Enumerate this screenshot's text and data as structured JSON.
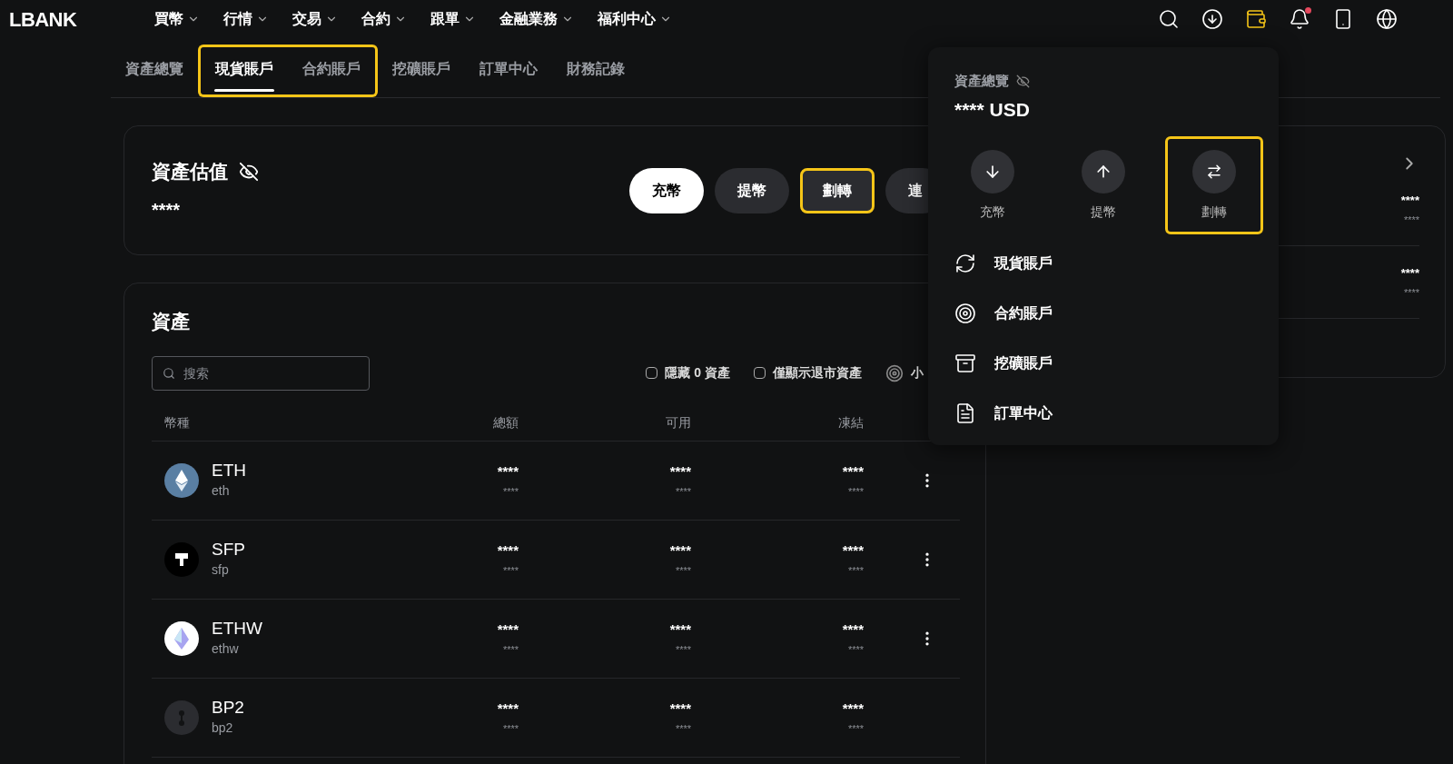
{
  "logo": "LBANK",
  "nav": [
    "買幣",
    "行情",
    "交易",
    "合約",
    "跟單",
    "金融業務",
    "福利中心"
  ],
  "header_icons": [
    {
      "kind": "search",
      "highlighted": false
    },
    {
      "kind": "download",
      "highlighted": false
    },
    {
      "kind": "wallet",
      "highlighted": true
    },
    {
      "kind": "bell",
      "unread": true,
      "highlighted": false
    },
    {
      "kind": "app",
      "highlighted": false
    },
    {
      "kind": "globe",
      "highlighted": false
    }
  ],
  "tabs": [
    {
      "label": "資產總覽",
      "selected": false,
      "highlighted": false
    },
    {
      "label": "現貨賬戶",
      "selected": true,
      "highlighted": true
    },
    {
      "label": "合約賬戶",
      "selected": false,
      "highlighted": true
    },
    {
      "label": "挖礦賬戶",
      "selected": false,
      "highlighted": false
    },
    {
      "label": "訂單中心",
      "selected": false,
      "highlighted": false
    },
    {
      "label": "財務記錄",
      "selected": false,
      "highlighted": false
    }
  ],
  "valuation": {
    "title": "資產估值",
    "value": "****",
    "buttons": [
      {
        "label": "充幣",
        "primary": true,
        "highlighted": false
      },
      {
        "label": "提幣",
        "primary": false,
        "highlighted": false
      },
      {
        "label": "劃轉",
        "primary": false,
        "highlighted": true
      },
      {
        "label": "連",
        "primary": false,
        "highlighted": false
      }
    ]
  },
  "assets": {
    "title": "資產",
    "search": {
      "placeholder": "搜索"
    },
    "filters": [
      {
        "kind": "checkbox",
        "label": "隱藏 0 資產",
        "checked": false
      },
      {
        "kind": "checkbox",
        "label": "僅顯示退市資產",
        "checked": false
      },
      {
        "kind": "toggle",
        "label": "小"
      }
    ],
    "columns": [
      "幣種",
      "總額",
      "可用",
      "凍結"
    ],
    "rows": [
      {
        "coin": "ETH",
        "code": "eth",
        "kind": "eth",
        "total": "****",
        "total_sub": "****",
        "available": "****",
        "available_sub": "****",
        "frozen": "****",
        "frozen_sub": "****",
        "menu": true
      },
      {
        "coin": "SFP",
        "code": "sfp",
        "kind": "sfp",
        "total": "****",
        "total_sub": "****",
        "available": "****",
        "available_sub": "****",
        "frozen": "****",
        "frozen_sub": "****",
        "menu": true
      },
      {
        "coin": "ETHW",
        "code": "ethw",
        "kind": "ethw",
        "total": "****",
        "total_sub": "****",
        "available": "****",
        "available_sub": "****",
        "frozen": "****",
        "frozen_sub": "****",
        "menu": true
      },
      {
        "coin": "BP2",
        "code": "bp2",
        "kind": "bp2",
        "total": "****",
        "total_sub": "****",
        "available": "****",
        "available_sub": "****",
        "frozen": "****",
        "frozen_sub": "****",
        "menu": false
      }
    ]
  },
  "side_card": {
    "rows": [
      {
        "value": "****",
        "sub": "****"
      },
      {
        "value": "****",
        "sub": "****"
      }
    ]
  },
  "dropdown": {
    "title": "資產總覽",
    "balance": "**** USD",
    "actions": [
      {
        "kind": "deposit",
        "label": "充幣",
        "highlighted": false
      },
      {
        "kind": "withdraw",
        "label": "提幣",
        "highlighted": false
      },
      {
        "kind": "transfer",
        "label": "劃轉",
        "highlighted": true
      }
    ],
    "links": [
      {
        "kind": "spot",
        "label": "現貨賬戶"
      },
      {
        "kind": "futures",
        "label": "合約賬戶"
      },
      {
        "kind": "mining",
        "label": "挖礦賬戶"
      },
      {
        "kind": "orders",
        "label": "訂單中心"
      }
    ]
  }
}
